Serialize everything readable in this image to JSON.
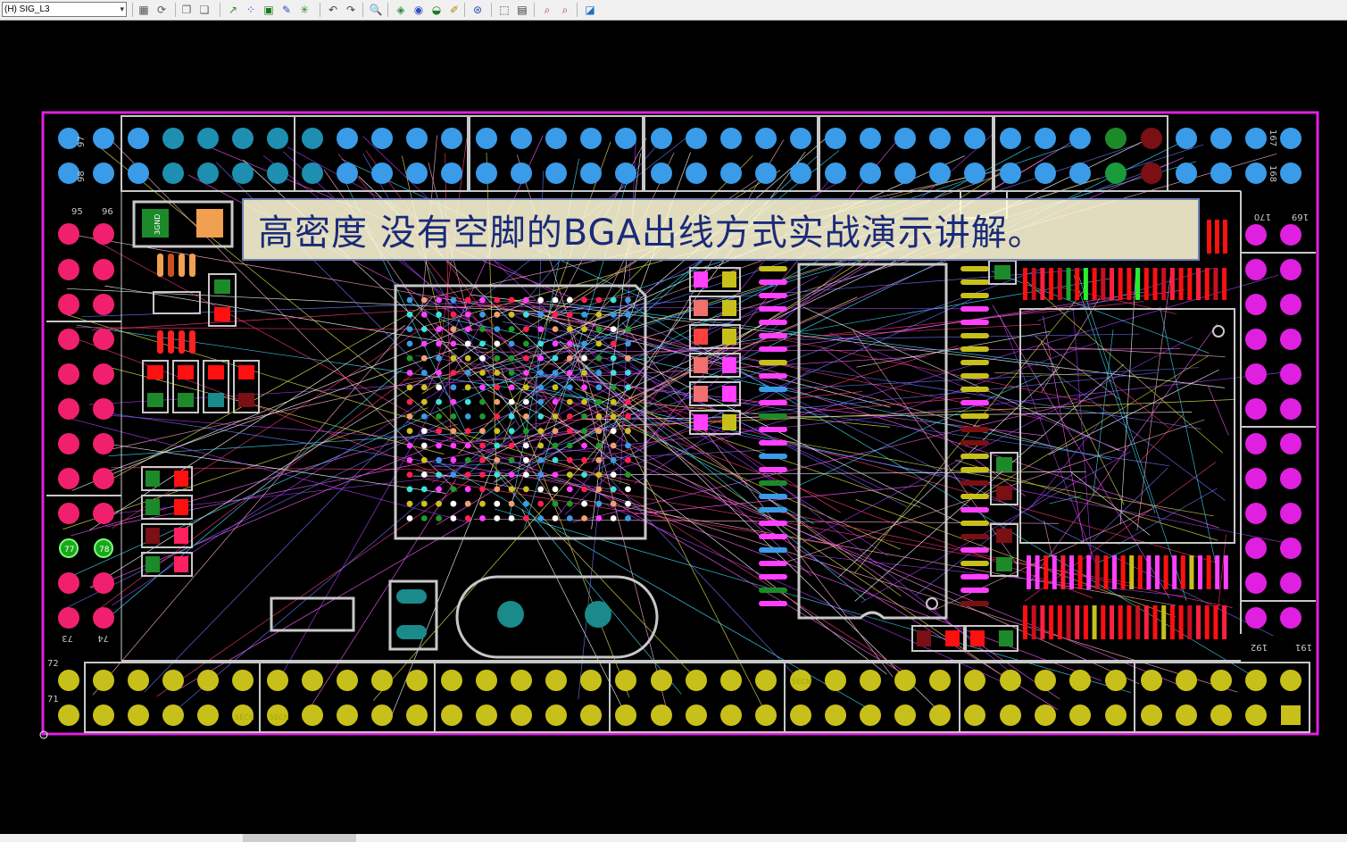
{
  "toolbar": {
    "layer_select": "(H) SIG_L3",
    "buttons": [
      {
        "name": "layer-settings-button",
        "icon": "layers-icon",
        "glyph": "▦",
        "color": "#555555"
      },
      {
        "name": "refresh-button",
        "icon": "refresh-icon",
        "glyph": "⟳",
        "color": "#555555"
      },
      {
        "name": "copy-button",
        "icon": "copy-icon",
        "glyph": "❐",
        "color": "#666666"
      },
      {
        "name": "paste-button",
        "icon": "paste-icon",
        "glyph": "❏",
        "color": "#666666"
      },
      {
        "name": "route-button",
        "icon": "route-icon",
        "glyph": "↗",
        "color": "#2e8b2e"
      },
      {
        "name": "dots-button",
        "icon": "grid-dots-icon",
        "glyph": "⁘",
        "color": "#2a4fbf"
      },
      {
        "name": "board-button",
        "icon": "board-icon",
        "glyph": "▣",
        "color": "#1e7a1e"
      },
      {
        "name": "pen-button",
        "icon": "pen-icon",
        "glyph": "✎",
        "color": "#2a4fbf"
      },
      {
        "name": "star-button",
        "icon": "spark-icon",
        "glyph": "✳",
        "color": "#2e8b2e"
      },
      {
        "name": "undo-button",
        "icon": "undo-icon",
        "glyph": "↶",
        "color": "#444444"
      },
      {
        "name": "redo-button",
        "icon": "redo-icon",
        "glyph": "↷",
        "color": "#444444"
      },
      {
        "name": "zoom-button",
        "icon": "magnifier-icon",
        "glyph": "🔍",
        "color": "#2a4fbf"
      },
      {
        "name": "tag-button",
        "icon": "tag-icon",
        "glyph": "◈",
        "color": "#2e8b2e"
      },
      {
        "name": "view-button",
        "icon": "view-icon",
        "glyph": "◉",
        "color": "#2a4fbf"
      },
      {
        "name": "cap-button",
        "icon": "cap-icon",
        "glyph": "◒",
        "color": "#1e7a1e"
      },
      {
        "name": "brush-button",
        "icon": "brush-icon",
        "glyph": "✐",
        "color": "#b8860b"
      },
      {
        "name": "target-button",
        "icon": "target-icon",
        "glyph": "⊛",
        "color": "#2a4fbf"
      },
      {
        "name": "select-button",
        "icon": "select-box-icon",
        "glyph": "⬚",
        "color": "#333333"
      },
      {
        "name": "window-button",
        "icon": "window-icon",
        "glyph": "▤",
        "color": "#333333"
      },
      {
        "name": "find-button",
        "icon": "find-icon",
        "glyph": "⌕",
        "color": "#c0392b"
      },
      {
        "name": "find-next-button",
        "icon": "find-next-icon",
        "glyph": "⌕",
        "color": "#c0392b"
      },
      {
        "name": "chart-button",
        "icon": "chart-icon",
        "glyph": "◪",
        "color": "#1e6fbf"
      }
    ]
  },
  "overlay": {
    "title": "高密度 没有空脚的BGA出线方式实战演示讲解。"
  },
  "board": {
    "pin_labels": {
      "top_left_a": "97",
      "top_left_b": "98",
      "left_a": "95",
      "left_b": "96",
      "left_c": "77",
      "left_d": "78",
      "left_e": "73",
      "left_f": "74",
      "bottom_left_a": "72",
      "bottom_left_b": "71",
      "top_right_a": "167",
      "top_right_b": "168",
      "right_a": "170",
      "right_b": "169",
      "right_c": "192",
      "right_d": "191"
    },
    "component_label": "3GND",
    "net_labels": [
      "5ECN",
      "5ECN",
      "5ECN"
    ],
    "colors": {
      "outline": "#e020e0",
      "silk": "#c8c8c8",
      "top_pads": "#3a9be8",
      "left_pads": "#f0206e",
      "right_pads": "#e020e0",
      "bottom_pads": "#c8c01a",
      "crystal_pads": "#1a8a8a",
      "green_pad": "#1d8a2a"
    }
  }
}
